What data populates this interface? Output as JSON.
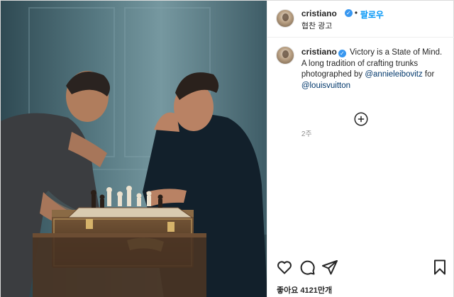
{
  "post": {
    "account": {
      "username": "cristiano",
      "verified_mark": "✓",
      "separator": "•",
      "follow_label": "팔로우",
      "sponsored_label": "협찬 광고"
    },
    "caption": {
      "username": "cristiano",
      "text": "Victory is a State of Mind. A long tradition of crafting trunks photographed by",
      "mention1": "@annieleibovitz",
      "mid": "for",
      "mention2": "@louisvuitton",
      "time": "2주"
    },
    "likes_label": "좋아요 4121만개",
    "icons": {
      "like": "heart-icon",
      "comment": "comment-icon",
      "share": "share-icon",
      "save": "bookmark-icon",
      "load_more": "plus-circle-icon"
    },
    "colors": {
      "accent": "#0095f6",
      "verified": "#3897f0",
      "mention": "#00376b",
      "muted": "#8e8e8e"
    }
  }
}
